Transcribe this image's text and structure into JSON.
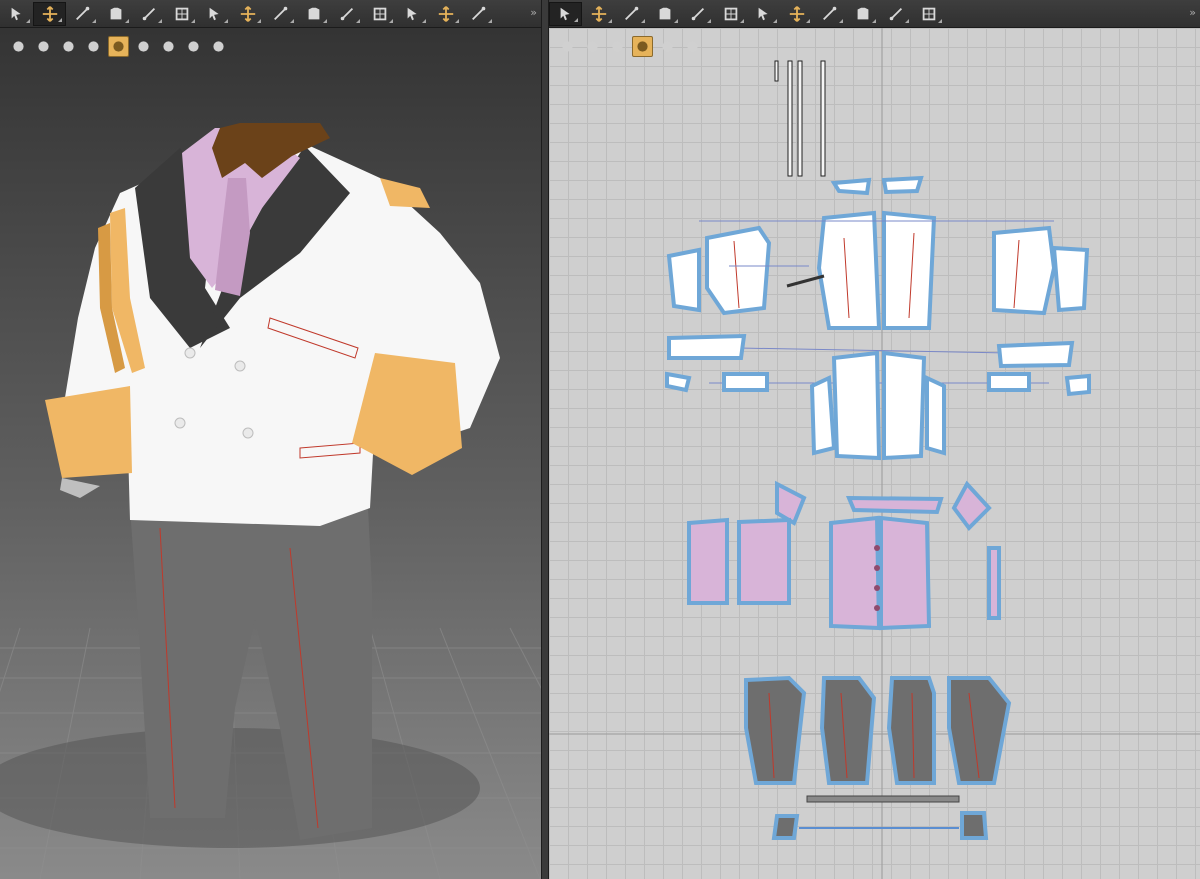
{
  "toolbar_3d": {
    "tools": [
      {
        "icon": "select-arrow-icon"
      },
      {
        "icon": "move-icon"
      },
      {
        "icon": "sew-needle-icon"
      },
      {
        "icon": "avatar-shirt-icon"
      },
      {
        "icon": "pin-icon"
      },
      {
        "icon": "fold-icon"
      },
      {
        "icon": "scale-icon"
      },
      {
        "icon": "tack-icon"
      },
      {
        "icon": "arrangement-icon"
      },
      {
        "icon": "grid-mesh-icon"
      },
      {
        "icon": "measure-icon"
      },
      {
        "icon": "hanger-icon"
      },
      {
        "icon": "button-icon"
      },
      {
        "icon": "zipper-icon"
      },
      {
        "icon": "flag-icon"
      }
    ]
  },
  "toolbar_2d": {
    "tools": [
      {
        "icon": "select-pattern-icon"
      },
      {
        "icon": "transform-icon"
      },
      {
        "icon": "rectangle-icon"
      },
      {
        "icon": "internal-line-icon"
      },
      {
        "icon": "dart-icon"
      },
      {
        "icon": "grid-mesh-icon"
      },
      {
        "icon": "iron-icon"
      },
      {
        "icon": "segment-sew-icon"
      },
      {
        "icon": "free-sew-icon"
      },
      {
        "icon": "pleat-icon"
      },
      {
        "icon": "edit-curve-icon"
      },
      {
        "icon": "shirt-icon"
      }
    ]
  },
  "viewport_3d": {
    "display_buttons": [
      {
        "icon": "texture-display-icon"
      },
      {
        "icon": "garment-display-icon"
      },
      {
        "icon": "stress-map-icon"
      },
      {
        "icon": "avatar-display-icon"
      },
      {
        "icon": "fabric-solid-icon"
      },
      {
        "icon": "fabric-thickness-icon"
      },
      {
        "icon": "avatar-body-icon"
      },
      {
        "icon": "globe-render-icon"
      },
      {
        "icon": "export-icon"
      }
    ]
  },
  "viewport_2d": {
    "display_buttons": [
      {
        "icon": "pattern-view-icon"
      },
      {
        "icon": "pattern-shirt-icon"
      },
      {
        "icon": "info-icon"
      },
      {
        "icon": "fabric-solid-icon"
      },
      {
        "icon": "texture-display-icon"
      },
      {
        "icon": "export-icon"
      }
    ]
  },
  "colors": {
    "jacket": "#f7f7f7",
    "lapel": "#3a3a3a",
    "shirt": "#d8b4d8",
    "tie": "#c49ac2",
    "cuff": "#f0b765",
    "collar": "#6b4219",
    "trousers": "#6e6e6e",
    "outline": "#6fa7d7",
    "seam": "#c0392b"
  }
}
